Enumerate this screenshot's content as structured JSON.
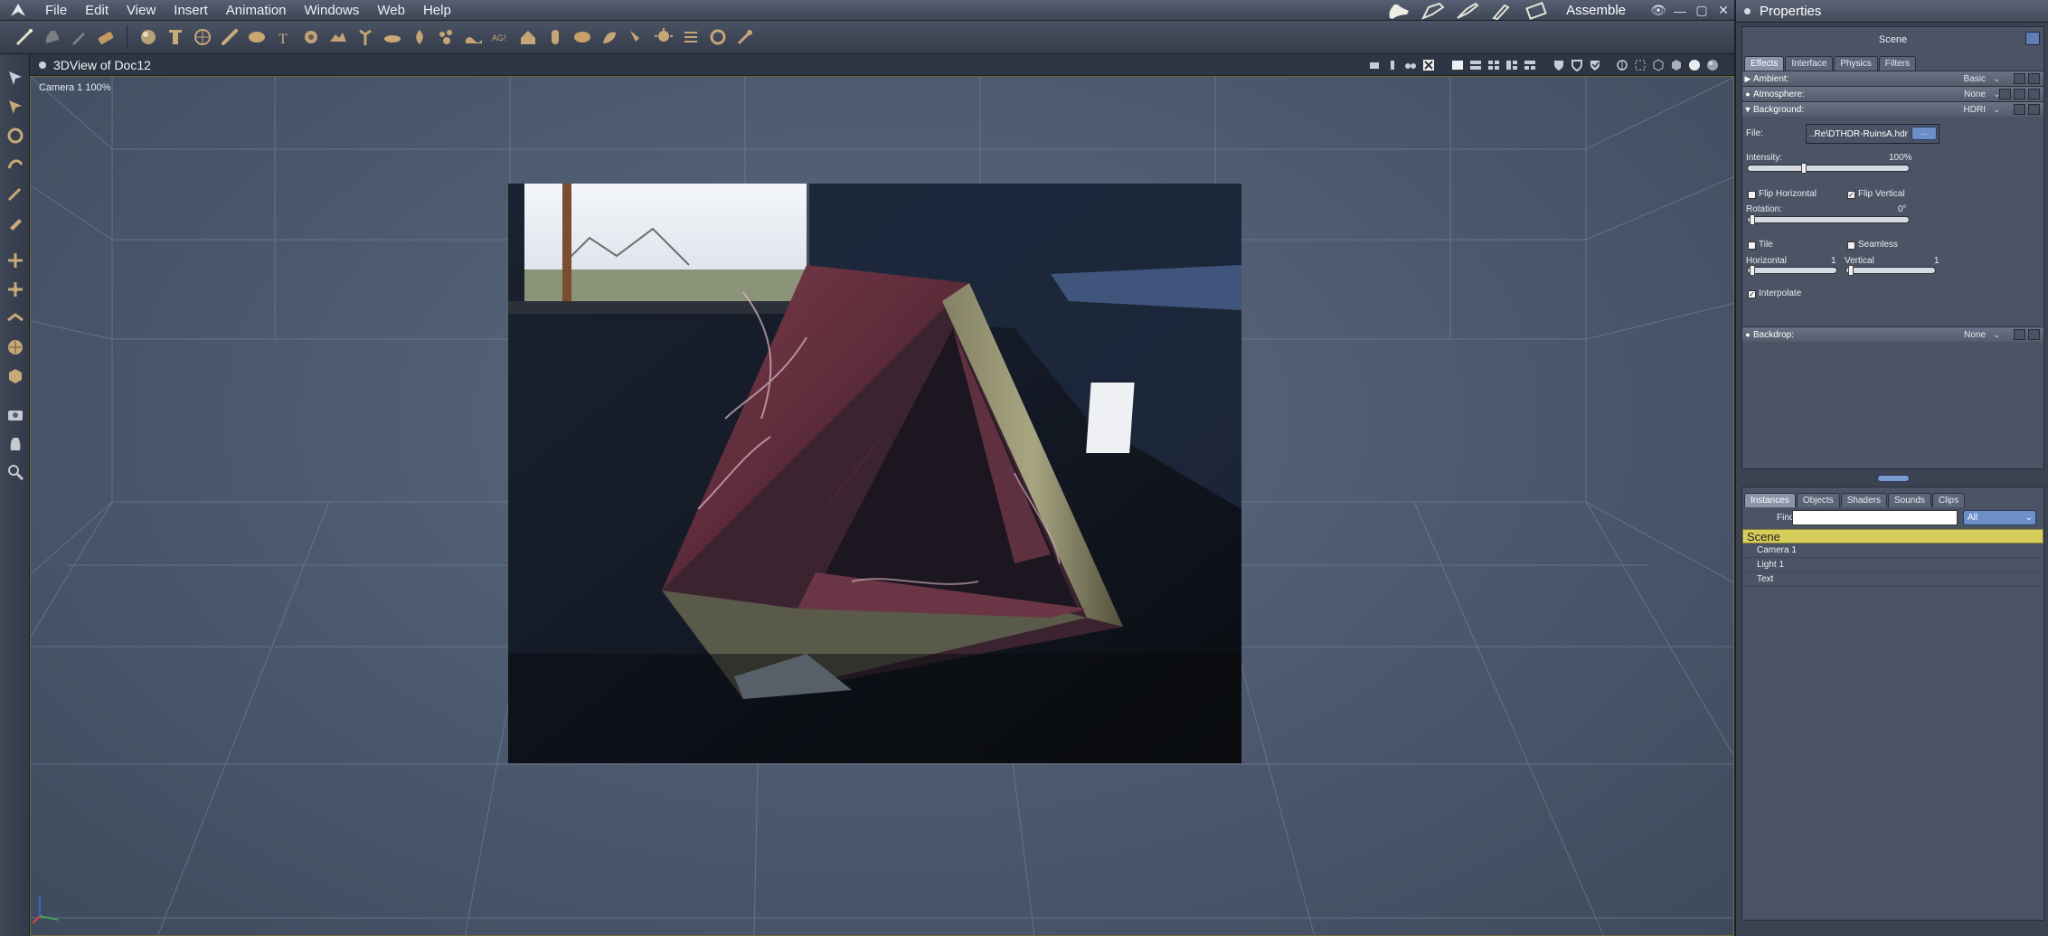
{
  "menubar": {
    "items": [
      "File",
      "Edit",
      "View",
      "Insert",
      "Animation",
      "Windows",
      "Web",
      "Help"
    ],
    "room": "Assemble"
  },
  "viewport": {
    "title": "3DView of Doc12",
    "camera_label": "Camera 1 100%"
  },
  "properties": {
    "title": "Properties",
    "scene_label": "Scene",
    "tabs": [
      "Effects",
      "Interface",
      "Physics",
      "Filters"
    ],
    "sections": {
      "ambient": {
        "name": "Ambient:",
        "value": "Basic"
      },
      "atmosphere": {
        "name": "Atmosphere:",
        "value": "None"
      },
      "background": {
        "name": "Background:",
        "value": "HDRI"
      },
      "backdrop": {
        "name": "Backdrop:",
        "value": "None"
      }
    },
    "background": {
      "file_label": "File:",
      "file_value": "..Re\\DTHDR-RuinsA.hdr",
      "file_button": "...",
      "intensity_label": "Intensity:",
      "intensity_value": "100%",
      "intensity_level": 0.34,
      "flip_horizontal": "Flip Horizontal",
      "flip_horizontal_checked": false,
      "flip_vertical": "Flip Vertical",
      "flip_vertical_checked": true,
      "rotation_label": "Rotation:",
      "rotation_value": "0°",
      "tile": "Tile",
      "tile_checked": false,
      "seamless": "Seamless",
      "seamless_checked": false,
      "horizontal_label": "Horizontal",
      "horizontal_value": "1",
      "vertical_label": "Vertical",
      "vertical_value": "1",
      "interpolate": "Interpolate",
      "interpolate_checked": true
    }
  },
  "browser": {
    "tabs": [
      "Instances",
      "Objects",
      "Shaders",
      "Sounds",
      "Clips"
    ],
    "find_label": "Find:",
    "find_value": "",
    "filter_value": "All",
    "tree_root": "Scene",
    "items": [
      "Camera 1",
      "Light 1",
      "Text"
    ]
  }
}
